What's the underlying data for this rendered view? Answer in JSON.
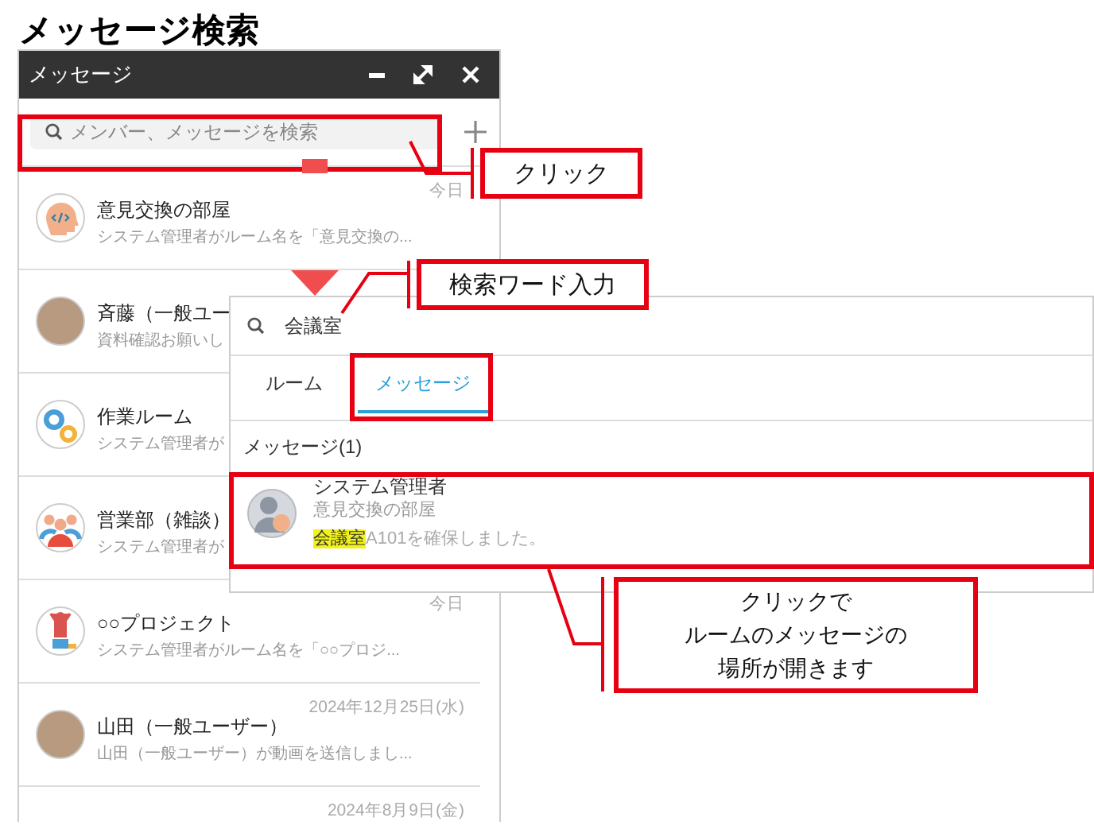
{
  "page_title": "メッセージ検索",
  "window": {
    "title": "メッセージ"
  },
  "search": {
    "placeholder": "メンバー、メッセージを検索"
  },
  "rooms": [
    {
      "kind": "head",
      "name": "意見交換の部屋",
      "preview": "システム管理者がルーム名を「意見交換の...",
      "date": "今日"
    },
    {
      "kind": "photo",
      "name": "斉藤（一般ユー",
      "preview": "資料確認お願いし"
    },
    {
      "kind": "gears",
      "name": "作業ルーム",
      "preview": "システム管理者が"
    },
    {
      "kind": "people",
      "name": "営業部（雑談）",
      "preview": "システム管理者が"
    },
    {
      "kind": "trophy",
      "name": "○○プロジェクト",
      "preview": "システム管理者がルーム名を「○○プロジ...",
      "date": "今日"
    },
    {
      "kind": "photo",
      "name": "山田（一般ユーザー）",
      "preview": "山田（一般ユーザー）が動画を送信しまし...",
      "date": "2024年12月25日(水)"
    },
    {
      "date": "2024年8月9日(金)"
    }
  ],
  "popup": {
    "query": "会議室",
    "tabs": [
      {
        "label": "ルーム",
        "selected": false
      },
      {
        "label": "メッセージ",
        "selected": true
      }
    ],
    "section": "メッセージ(1)",
    "results": [
      {
        "sender": "システム管理者",
        "room": "意見交換の部屋",
        "text": "**会議室**A101を確保しました。"
      }
    ]
  },
  "callouts": [
    {
      "lines": [
        "クリック"
      ]
    },
    {
      "lines": [
        "検索ワード入力"
      ]
    },
    {
      "lines": [
        "クリックで",
        "ルームのメッセージの",
        "場所が開きます"
      ]
    }
  ]
}
